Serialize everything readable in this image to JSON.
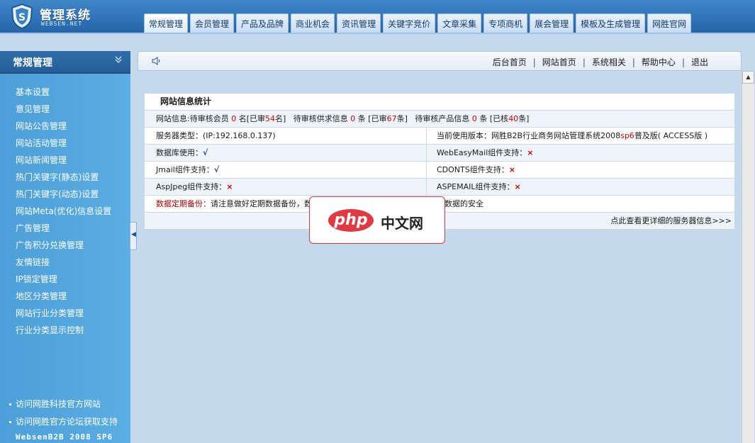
{
  "header": {
    "logo_title": "管理系统",
    "logo_sub": "WEBSEN.NET",
    "tabs": [
      "常规管理",
      "会员管理",
      "产品及品牌",
      "商业机会",
      "资讯管理",
      "关键字竞价",
      "文章采集",
      "专项商机",
      "展会管理",
      "模板及生成管理",
      "网胜官网"
    ]
  },
  "sidebar": {
    "title": "常规管理",
    "collapse_icon": "double-chevron-down",
    "items": [
      "基本设置",
      "意见管理",
      "网站公告管理",
      "网站活动管理",
      "网站新闻管理",
      "热门关键字(静态)设置",
      "热门关键字(动态)设置",
      "网站Meta(优化)信息设置",
      "广告管理",
      "广告积分兑换管理",
      "友情链接",
      "IP锁定管理",
      "地区分类管理",
      "网站行业分类管理",
      "行业分类显示控制"
    ],
    "links": [
      "访问网胜科技官方网站",
      "访问网胜官方论坛获取支持"
    ],
    "version": "WebsenB2B 2008 SP6"
  },
  "topbar": {
    "links": [
      "后台首页",
      "网站首页",
      "系统相关",
      "帮助中心",
      "退出"
    ],
    "sep": "|"
  },
  "stats": {
    "title": "网站信息统计",
    "info": {
      "p1": "网站信息:待审核会员 ",
      "n1": "0",
      "p2": " 名[已审",
      "n2": "54",
      "p3": "名]",
      "p4": "   待审核供求信息 ",
      "n3": "0",
      "p5": " 条 [已审",
      "n4": "67",
      "p6": "条]",
      "p7": "   待审核产品信息 ",
      "n5": "0",
      "p8": " 条 [已核",
      "n6": "40",
      "p9": "条]"
    },
    "server_type": "服务器类型：(IP:192.168.0.137)",
    "version_label": "当前使用版本：网胜B2B行业商务网站管理系统2008",
    "version_sp": "sp6",
    "version_tail": "普及版( ACCESS版 )",
    "db_label": "数据库使用：",
    "webeasymail_label": "WebEasyMail组件支持：",
    "jmail_label": "Jmail组件支持：",
    "cdonts_label": "CDONTS组件支持：",
    "aspjpeg_label": "AspJpeg组件支持：",
    "aspemail_label": "ASPEMAIL组件支持：",
    "check": "√",
    "cross": "×",
    "backup_label": "数据定期备份：",
    "backup_text": "请注意做好定期数据备份，数据的定期备份可最大限度的保护您网站数据的安全",
    "more": "点此查看更详细的服务器信息>>>"
  },
  "watermark": {
    "php": "php",
    "cn": "中文网"
  },
  "colors": {
    "accent": "#2f73b6",
    "sidebar": "#4c9fd8",
    "alert": "#d00000"
  }
}
